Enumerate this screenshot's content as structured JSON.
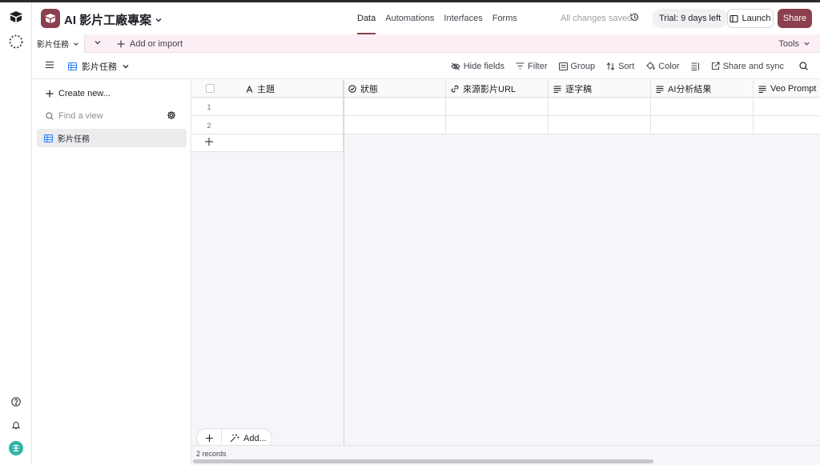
{
  "app": {
    "base_name": "AI 影片工廠專案"
  },
  "header": {
    "nav": [
      {
        "label": "Data",
        "active": true
      },
      {
        "label": "Automations",
        "active": false
      },
      {
        "label": "Interfaces",
        "active": false
      },
      {
        "label": "Forms",
        "active": false
      }
    ],
    "saved_status": "All changes saved",
    "trial_badge": "Trial: 9 days left",
    "launch_label": "Launch",
    "share_label": "Share",
    "accent_color": "#8c3f4d"
  },
  "tablebar": {
    "active_table": "影片任務",
    "add_import": "Add or import",
    "tools": "Tools"
  },
  "viewbar": {
    "view_name": "影片任務",
    "hide_fields": "Hide fields",
    "filter": "Filter",
    "group": "Group",
    "sort": "Sort",
    "color": "Color",
    "share_sync": "Share and sync"
  },
  "sidebar": {
    "create_new": "Create new...",
    "find_placeholder": "Find a view",
    "views": [
      {
        "label": "影片任務",
        "active": true
      }
    ]
  },
  "grid": {
    "columns": [
      {
        "label": "主題",
        "icon": "text-icon"
      },
      {
        "label": "狀態",
        "icon": "status-icon"
      },
      {
        "label": "來源影片URL",
        "icon": "link-icon"
      },
      {
        "label": "逐字稿",
        "icon": "long-text-icon"
      },
      {
        "label": "AI分析結果",
        "icon": "long-text-icon"
      },
      {
        "label": "Veo Prompt",
        "icon": "long-text-icon"
      }
    ],
    "rows": [
      {
        "num": "1"
      },
      {
        "num": "2"
      }
    ],
    "add_label": "Add...",
    "record_count": "2 records"
  }
}
